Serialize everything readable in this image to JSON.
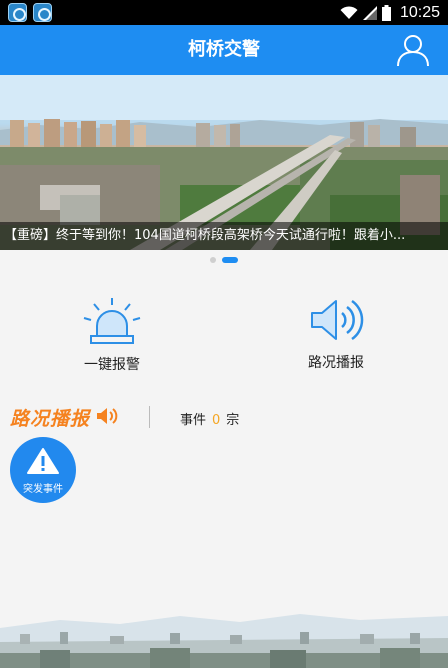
{
  "status_bar": {
    "time": "10:25"
  },
  "app_bar": {
    "title": "柯桥交警"
  },
  "banner": {
    "caption": "【重磅】终于等到你！104国道柯桥段高架桥今天试通行啦！跟着小...",
    "active_slide": 2,
    "slide_count": 2
  },
  "actions": {
    "alarm_label": "一键报警",
    "traffic_label": "路况播报"
  },
  "section": {
    "title": "路况播报",
    "event_prefix": "事件",
    "event_count": "0",
    "event_suffix": "宗"
  },
  "emergency": {
    "label": "突发事件"
  },
  "colors": {
    "primary": "#1e8df2",
    "accent_orange": "#f5821f",
    "count_color": "#f5a623",
    "background": "#f4f4f4"
  },
  "icons": [
    "wifi-icon",
    "signal-icon",
    "battery-icon",
    "user-icon",
    "siren-icon",
    "speaker-icon",
    "warning-icon"
  ]
}
